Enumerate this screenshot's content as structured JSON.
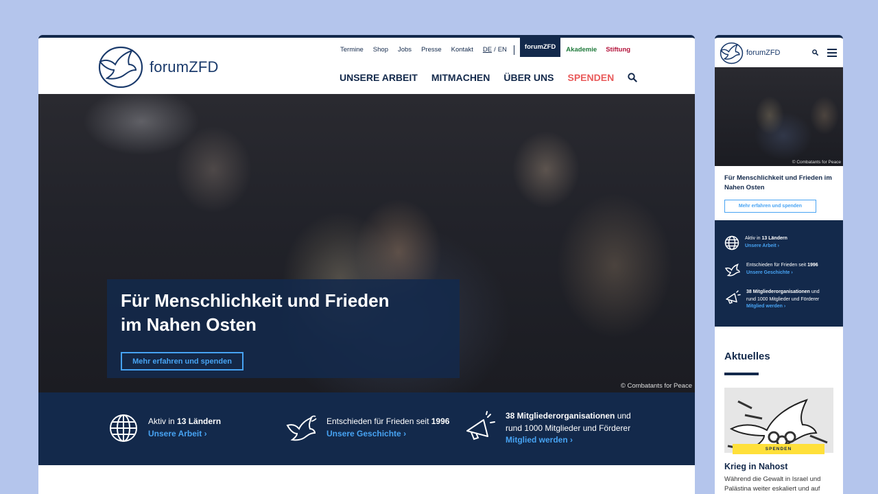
{
  "desktop": {
    "brand": "forumZFD",
    "topnav": {
      "items": [
        "Termine",
        "Shop",
        "Jobs",
        "Presse",
        "Kontakt"
      ],
      "lang_de": "DE",
      "lang_sep": "/",
      "lang_en": "EN",
      "pill": "forumZFD",
      "akademie": "Akademie",
      "stiftung": "Stiftung"
    },
    "mainnav": {
      "items": [
        "UNSERE ARBEIT",
        "MITMACHEN",
        "ÜBER UNS"
      ],
      "donate": "SPENDEN"
    },
    "hero": {
      "title_line1": "Für Menschlichkeit und Frieden",
      "title_line2": "im Nahen Osten",
      "button": "Mehr erfahren und spenden",
      "credit": "© Combatants for Peace"
    },
    "stats": [
      {
        "icon": "globe-icon",
        "pre": "Aktiv in ",
        "bold": "13 Ländern",
        "post": "",
        "line2": "",
        "link": "Unsere Arbeit"
      },
      {
        "icon": "dove-icon",
        "pre": "Entschieden für Frieden seit ",
        "bold": "1996",
        "post": "",
        "line2": "",
        "link": "Unsere Geschichte"
      },
      {
        "icon": "megaphone-icon",
        "pre": "",
        "bold": "38 Mitgliederorganisationen",
        "post": " und",
        "line2": "rund 1000 Mitglieder und Förderer",
        "link": "Mitglied werden"
      }
    ],
    "link_chevron": "›"
  },
  "mobile": {
    "brand": "forumZFD",
    "hero_credit": "© Combatants for Peace",
    "title": "Für Menschlichkeit und Frieden im Nahen Osten",
    "button": "Mehr erfahren und spenden",
    "stats": [
      {
        "pre": "Aktiv in ",
        "bold": "13 Ländern",
        "post": "",
        "line2": "",
        "link": "Unsere Arbeit"
      },
      {
        "pre": "Entschieden für Frieden seit ",
        "bold": "1996",
        "post": "",
        "line2": "",
        "link": "Unsere Geschichte"
      },
      {
        "pre": "",
        "bold": "38 Mitgliederorganisationen",
        "post": " und",
        "line2": "rund 1000 Mitglieder und Förderer",
        "link": "Mitglied werden"
      }
    ],
    "news_heading": "Aktuelles",
    "card": {
      "badge": "SPENDEN",
      "title": "Krieg in Nahost",
      "text": "Während die Gewalt in Israel und Palästina weiter eskaliert und auf"
    }
  },
  "colors": {
    "navy": "#13294b",
    "link_blue": "#47a3f3",
    "donate_red": "#e95a5a",
    "akademie_green": "#1f7a3b",
    "stiftung_red": "#b3123a",
    "badge_yellow": "#ffe03a",
    "background": "#b4c5ec"
  }
}
